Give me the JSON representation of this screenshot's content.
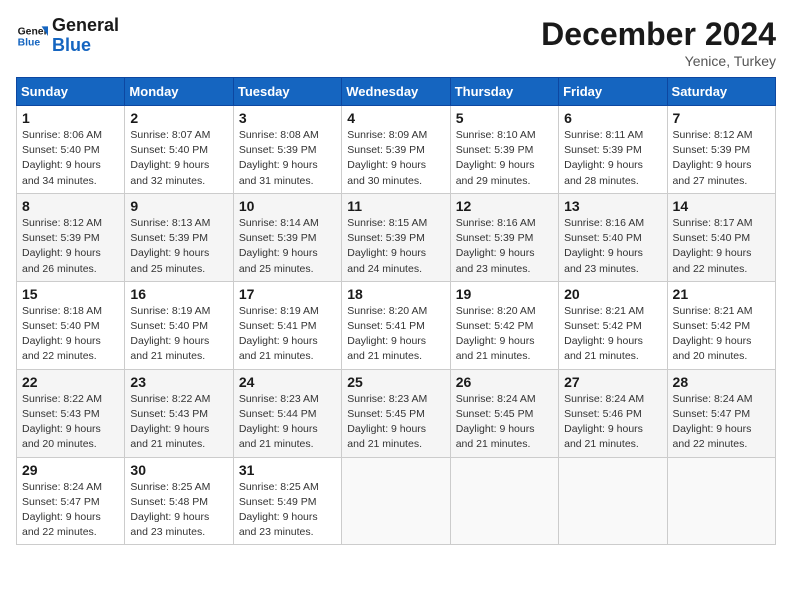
{
  "header": {
    "logo_general": "General",
    "logo_blue": "Blue",
    "month": "December 2024",
    "location": "Yenice, Turkey"
  },
  "days_of_week": [
    "Sunday",
    "Monday",
    "Tuesday",
    "Wednesday",
    "Thursday",
    "Friday",
    "Saturday"
  ],
  "weeks": [
    [
      {
        "day": "1",
        "sunrise": "Sunrise: 8:06 AM",
        "sunset": "Sunset: 5:40 PM",
        "daylight": "Daylight: 9 hours and 34 minutes."
      },
      {
        "day": "2",
        "sunrise": "Sunrise: 8:07 AM",
        "sunset": "Sunset: 5:40 PM",
        "daylight": "Daylight: 9 hours and 32 minutes."
      },
      {
        "day": "3",
        "sunrise": "Sunrise: 8:08 AM",
        "sunset": "Sunset: 5:39 PM",
        "daylight": "Daylight: 9 hours and 31 minutes."
      },
      {
        "day": "4",
        "sunrise": "Sunrise: 8:09 AM",
        "sunset": "Sunset: 5:39 PM",
        "daylight": "Daylight: 9 hours and 30 minutes."
      },
      {
        "day": "5",
        "sunrise": "Sunrise: 8:10 AM",
        "sunset": "Sunset: 5:39 PM",
        "daylight": "Daylight: 9 hours and 29 minutes."
      },
      {
        "day": "6",
        "sunrise": "Sunrise: 8:11 AM",
        "sunset": "Sunset: 5:39 PM",
        "daylight": "Daylight: 9 hours and 28 minutes."
      },
      {
        "day": "7",
        "sunrise": "Sunrise: 8:12 AM",
        "sunset": "Sunset: 5:39 PM",
        "daylight": "Daylight: 9 hours and 27 minutes."
      }
    ],
    [
      {
        "day": "8",
        "sunrise": "Sunrise: 8:12 AM",
        "sunset": "Sunset: 5:39 PM",
        "daylight": "Daylight: 9 hours and 26 minutes."
      },
      {
        "day": "9",
        "sunrise": "Sunrise: 8:13 AM",
        "sunset": "Sunset: 5:39 PM",
        "daylight": "Daylight: 9 hours and 25 minutes."
      },
      {
        "day": "10",
        "sunrise": "Sunrise: 8:14 AM",
        "sunset": "Sunset: 5:39 PM",
        "daylight": "Daylight: 9 hours and 25 minutes."
      },
      {
        "day": "11",
        "sunrise": "Sunrise: 8:15 AM",
        "sunset": "Sunset: 5:39 PM",
        "daylight": "Daylight: 9 hours and 24 minutes."
      },
      {
        "day": "12",
        "sunrise": "Sunrise: 8:16 AM",
        "sunset": "Sunset: 5:39 PM",
        "daylight": "Daylight: 9 hours and 23 minutes."
      },
      {
        "day": "13",
        "sunrise": "Sunrise: 8:16 AM",
        "sunset": "Sunset: 5:40 PM",
        "daylight": "Daylight: 9 hours and 23 minutes."
      },
      {
        "day": "14",
        "sunrise": "Sunrise: 8:17 AM",
        "sunset": "Sunset: 5:40 PM",
        "daylight": "Daylight: 9 hours and 22 minutes."
      }
    ],
    [
      {
        "day": "15",
        "sunrise": "Sunrise: 8:18 AM",
        "sunset": "Sunset: 5:40 PM",
        "daylight": "Daylight: 9 hours and 22 minutes."
      },
      {
        "day": "16",
        "sunrise": "Sunrise: 8:19 AM",
        "sunset": "Sunset: 5:40 PM",
        "daylight": "Daylight: 9 hours and 21 minutes."
      },
      {
        "day": "17",
        "sunrise": "Sunrise: 8:19 AM",
        "sunset": "Sunset: 5:41 PM",
        "daylight": "Daylight: 9 hours and 21 minutes."
      },
      {
        "day": "18",
        "sunrise": "Sunrise: 8:20 AM",
        "sunset": "Sunset: 5:41 PM",
        "daylight": "Daylight: 9 hours and 21 minutes."
      },
      {
        "day": "19",
        "sunrise": "Sunrise: 8:20 AM",
        "sunset": "Sunset: 5:42 PM",
        "daylight": "Daylight: 9 hours and 21 minutes."
      },
      {
        "day": "20",
        "sunrise": "Sunrise: 8:21 AM",
        "sunset": "Sunset: 5:42 PM",
        "daylight": "Daylight: 9 hours and 21 minutes."
      },
      {
        "day": "21",
        "sunrise": "Sunrise: 8:21 AM",
        "sunset": "Sunset: 5:42 PM",
        "daylight": "Daylight: 9 hours and 20 minutes."
      }
    ],
    [
      {
        "day": "22",
        "sunrise": "Sunrise: 8:22 AM",
        "sunset": "Sunset: 5:43 PM",
        "daylight": "Daylight: 9 hours and 20 minutes."
      },
      {
        "day": "23",
        "sunrise": "Sunrise: 8:22 AM",
        "sunset": "Sunset: 5:43 PM",
        "daylight": "Daylight: 9 hours and 21 minutes."
      },
      {
        "day": "24",
        "sunrise": "Sunrise: 8:23 AM",
        "sunset": "Sunset: 5:44 PM",
        "daylight": "Daylight: 9 hours and 21 minutes."
      },
      {
        "day": "25",
        "sunrise": "Sunrise: 8:23 AM",
        "sunset": "Sunset: 5:45 PM",
        "daylight": "Daylight: 9 hours and 21 minutes."
      },
      {
        "day": "26",
        "sunrise": "Sunrise: 8:24 AM",
        "sunset": "Sunset: 5:45 PM",
        "daylight": "Daylight: 9 hours and 21 minutes."
      },
      {
        "day": "27",
        "sunrise": "Sunrise: 8:24 AM",
        "sunset": "Sunset: 5:46 PM",
        "daylight": "Daylight: 9 hours and 21 minutes."
      },
      {
        "day": "28",
        "sunrise": "Sunrise: 8:24 AM",
        "sunset": "Sunset: 5:47 PM",
        "daylight": "Daylight: 9 hours and 22 minutes."
      }
    ],
    [
      {
        "day": "29",
        "sunrise": "Sunrise: 8:24 AM",
        "sunset": "Sunset: 5:47 PM",
        "daylight": "Daylight: 9 hours and 22 minutes."
      },
      {
        "day": "30",
        "sunrise": "Sunrise: 8:25 AM",
        "sunset": "Sunset: 5:48 PM",
        "daylight": "Daylight: 9 hours and 23 minutes."
      },
      {
        "day": "31",
        "sunrise": "Sunrise: 8:25 AM",
        "sunset": "Sunset: 5:49 PM",
        "daylight": "Daylight: 9 hours and 23 minutes."
      },
      null,
      null,
      null,
      null
    ]
  ]
}
